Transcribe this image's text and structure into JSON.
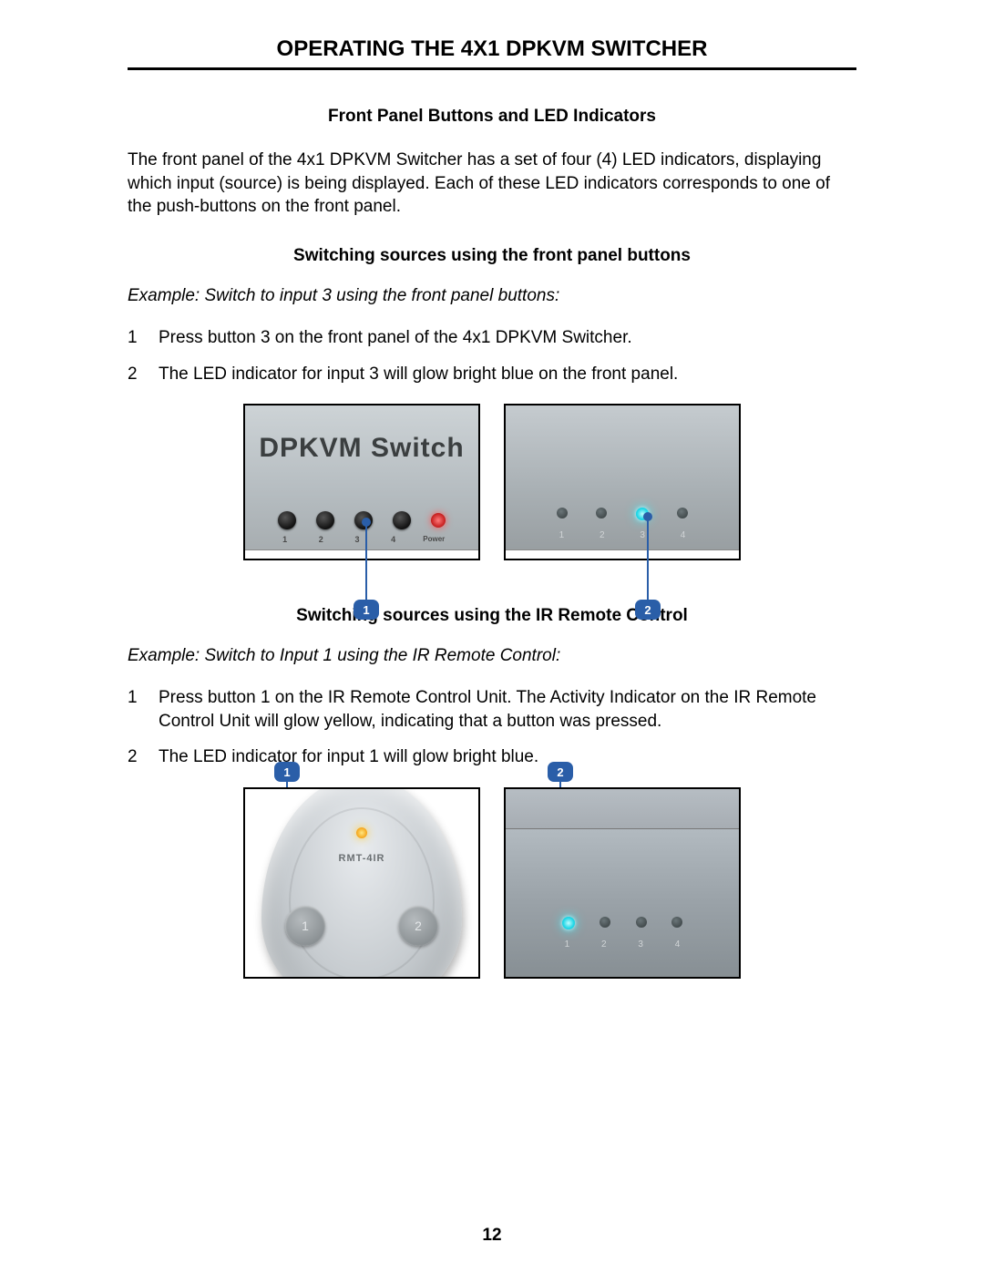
{
  "page_title": "OPERATING THE 4X1 DPKVM SWITCHER",
  "section1": {
    "heading": "Front Panel Buttons and LED Indicators",
    "body": "The front panel of the 4x1 DPKVM Switcher has a set of four (4) LED indicators, displaying which input (source) is being displayed.  Each of these LED indicators corresponds to one of the push-buttons on the front panel."
  },
  "section2": {
    "heading": "Switching sources using the front panel buttons",
    "example": "Example: Switch to input 3 using the front panel buttons:",
    "steps": [
      {
        "num": "1",
        "text": "Press button 3 on the front panel of the 4x1 DPKVM Switcher."
      },
      {
        "num": "2",
        "text": "The LED indicator for input 3 will glow bright blue on the front panel."
      }
    ]
  },
  "fig1": {
    "photo_text": "DPKVM Switch",
    "btn_labels": [
      "1",
      "2",
      "3",
      "4"
    ],
    "pwr_label": "Power",
    "callout1": "1",
    "callout2": "2",
    "led_labels": [
      "1",
      "2",
      "3",
      "4"
    ]
  },
  "section3": {
    "heading": "Switching sources using the IR Remote Control",
    "example": "Example: Switch to Input 1 using the IR Remote Control:",
    "steps": [
      {
        "num": "1",
        "text": "Press button 1 on the IR Remote Control Unit.  The Activity Indicator on the IR Remote Control Unit will glow yellow, indicating that a button was pressed."
      },
      {
        "num": "2",
        "text": "The LED indicator for input 1 will glow bright blue."
      }
    ]
  },
  "fig2": {
    "remote_text": "RMT-4IR",
    "remote_btn1": "1",
    "remote_btn2": "2",
    "callout1": "1",
    "callout2": "2",
    "led_labels": [
      "1",
      "2",
      "3",
      "4"
    ]
  },
  "page_number": "12"
}
